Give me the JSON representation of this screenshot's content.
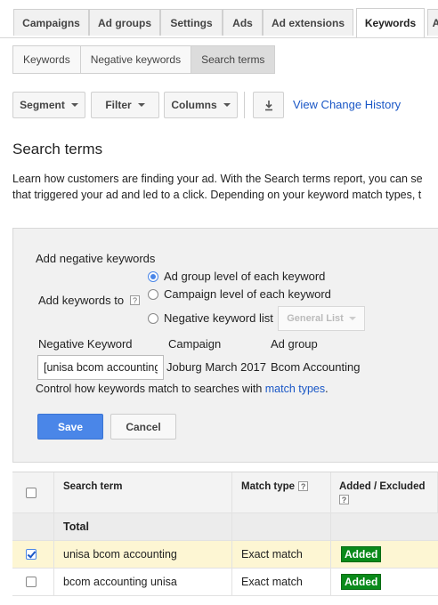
{
  "tabs": [
    "Campaigns",
    "Ad groups",
    "Settings",
    "Ads",
    "Ad extensions",
    "Keywords",
    "A"
  ],
  "subtabs": [
    "Keywords",
    "Negative keywords",
    "Search terms"
  ],
  "toolbar": {
    "segment": "Segment",
    "filter": "Filter",
    "columns": "Columns",
    "view_change_history": "View Change History"
  },
  "page": {
    "title": "Search terms",
    "desc_line1": "Learn how customers are finding your ad. With the Search terms report, you can se",
    "desc_line2": "that triggered your ad and led to a click. Depending on your keyword match types, t"
  },
  "panel": {
    "heading": "Add negative keywords",
    "add_keywords_to": "Add keywords to",
    "help": "?",
    "options": [
      "Ad group level of each keyword",
      "Campaign level of each keyword",
      "Negative keyword list"
    ],
    "list_dropdown": "General List",
    "col_negative_keyword": "Negative Keyword",
    "col_campaign": "Campaign",
    "col_ad_group": "Ad group",
    "keyword_value": "[unisa bcom accounting",
    "campaign_value": "Joburg March 2017",
    "ad_group_value": "Bcom Accounting",
    "control_text": "Control how keywords match to searches with ",
    "match_types_link": "match types",
    "period": ".",
    "save": "Save",
    "cancel": "Cancel"
  },
  "table": {
    "headers": {
      "search_term": "Search term",
      "match_type": "Match type",
      "added_excluded": "Added / Excluded",
      "help": "?"
    },
    "total_label": "Total",
    "rows": [
      {
        "term": "unisa bcom accounting",
        "match": "Exact match",
        "status": "Added"
      },
      {
        "term": "bcom accounting unisa",
        "match": "Exact match",
        "status": "Added"
      }
    ]
  },
  "colors": {
    "accent": "#4a86e8",
    "link": "#1a57c6",
    "added_badge": "#0a8a1a",
    "selected_row": "#fdf6d3"
  }
}
